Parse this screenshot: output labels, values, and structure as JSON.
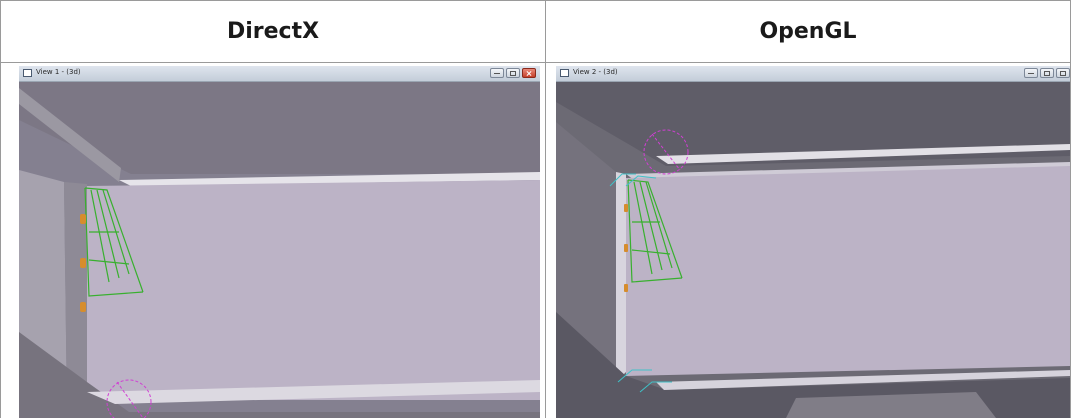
{
  "table": {
    "headers": [
      "DirectX",
      "OpenGL"
    ]
  },
  "views": [
    {
      "title": "View 1 - (3d)",
      "renderer": "DirectX"
    },
    {
      "title": "View 2 - (3d)",
      "renderer": "OpenGL"
    }
  ],
  "icons": {
    "window_minimize": "minimize-icon",
    "window_maximize": "maximize-icon",
    "window_close": "close-icon",
    "view_window": "view-window-icon"
  },
  "colors": {
    "beam_face": "#bcb3c6",
    "flange_top": "#77737e",
    "connection_lines": "#38b02e",
    "bolts": "#d68d2d",
    "magenta_marker": "#d03fd3",
    "cyan_marker": "#3fc2c8"
  }
}
